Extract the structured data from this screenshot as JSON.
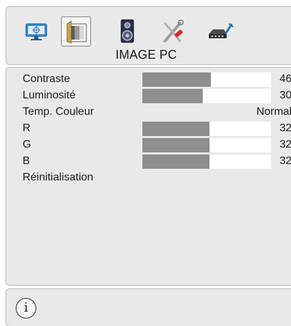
{
  "menu": {
    "icons": [
      {
        "name": "monitor-icon",
        "selected": false
      },
      {
        "name": "image-pc-icon",
        "selected": true
      },
      {
        "name": "speaker-icon",
        "selected": false
      },
      {
        "name": "tools-icon",
        "selected": false
      },
      {
        "name": "settings-box-icon",
        "selected": false
      }
    ],
    "title": "IMAGE PC"
  },
  "items": [
    {
      "label": "Contraste",
      "value": "46",
      "bar_fraction": 0.53
    },
    {
      "label": "Luminosité",
      "value": "30",
      "bar_fraction": 0.47
    },
    {
      "label": "Temp. Couleur",
      "value": "Normal"
    },
    {
      "label": "R",
      "value": "32",
      "bar_fraction": 0.52
    },
    {
      "label": "G",
      "value": "32",
      "bar_fraction": 0.52
    },
    {
      "label": "B",
      "value": "32",
      "bar_fraction": 0.52
    },
    {
      "label": "Réinitialisation"
    }
  ],
  "footer": {
    "info_glyph": "i"
  },
  "colors": {
    "panel": "#e9e9e9",
    "bar_fill": "#8e8e8e",
    "bar_track": "#ffffff"
  }
}
